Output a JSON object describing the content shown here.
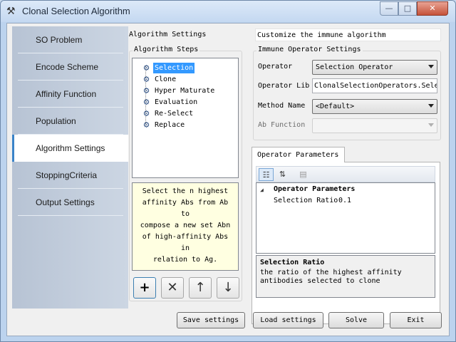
{
  "window": {
    "title": "Clonal Selection Algorithm",
    "minimize_label": "—",
    "maximize_label": "□",
    "close_label": "✕",
    "app_icon": "wrench-icon"
  },
  "nav": {
    "items": [
      {
        "label": "SO Problem"
      },
      {
        "label": "Encode Scheme"
      },
      {
        "label": "Affinity Function"
      },
      {
        "label": "Population"
      },
      {
        "label": "Algorithm Settings"
      },
      {
        "label": "StoppingCriteria"
      },
      {
        "label": "Output Settings"
      }
    ],
    "active_index": 4
  },
  "algorithm": {
    "section_title": "Algorithm Settings",
    "steps_title": "Algorithm Steps",
    "steps": [
      {
        "label": "Selection"
      },
      {
        "label": "Clone"
      },
      {
        "label": "Hyper Maturate"
      },
      {
        "label": "Evaluation"
      },
      {
        "label": "Re-Select"
      },
      {
        "label": "Replace"
      }
    ],
    "selected_step": 0,
    "description": "Select the n highest\naffinity Abs from Ab to\ncompose a new set  Abn\nof high-affinity Abs in\nrelation to Ag.",
    "step_buttons": {
      "add": "+",
      "remove": "✕",
      "up": "↑",
      "down": "↓"
    }
  },
  "immune": {
    "header": "Customize the immune algorithm",
    "group_title": "Immune Operator Settings",
    "operator_label": "Operator",
    "operator_value": "Selection Operator",
    "operator_lib_label": "Operator Lib",
    "operator_lib_value": "ClonalSelectionOperators.Sele",
    "method_label": "Method Name",
    "method_value": "<Default>",
    "ab_function_label": "Ab Function",
    "ab_function_value": ""
  },
  "parameters": {
    "tab_label": "Operator Parameters",
    "toolbar": {
      "categorized_icon": "☷",
      "alphabetical_icon": "⇅",
      "property_pages_icon": "▤"
    },
    "category": "Operator Parameters",
    "expand_glyph": "◢",
    "rows": [
      {
        "name": "Selection Ratio",
        "value": "0.1"
      }
    ],
    "help_title": "Selection Ratio",
    "help_text": "the ratio of the highest affinity\nantibodies selected to clone"
  },
  "footer": {
    "save": "Save settings",
    "load": "Load settings",
    "solve": "Solve",
    "exit": "Exit"
  },
  "colors": {
    "accent": "#3a83c8",
    "selection": "#3399ff",
    "description_bg": "#ffffe1"
  }
}
